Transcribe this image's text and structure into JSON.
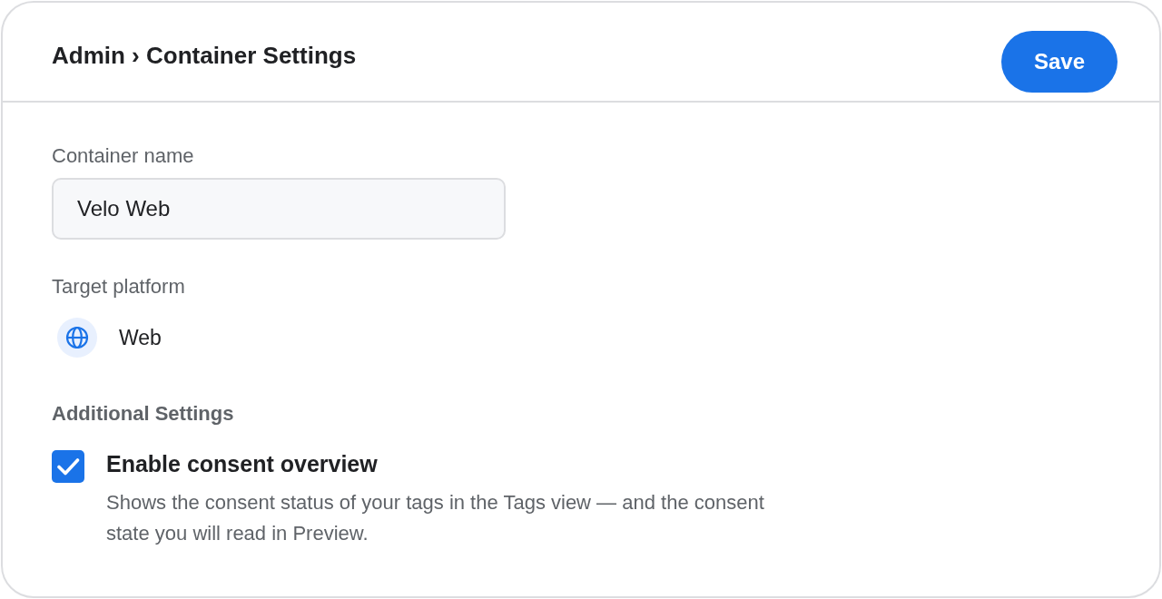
{
  "header": {
    "breadcrumb": "Admin › Container Settings",
    "save_button": "Save"
  },
  "fields": [
    {
      "kind": "text",
      "label": "Container name",
      "value": "Velo Web"
    },
    {
      "kind": "platform",
      "label": "Target platform",
      "value": "Web"
    }
  ],
  "additional_settings": {
    "heading": "Additional Settings",
    "options": [
      {
        "label": "Enable consent overview",
        "description": "Shows the consent status of your tags in the Tags view — and the consent state you will read in Preview.",
        "checked": true
      }
    ]
  }
}
